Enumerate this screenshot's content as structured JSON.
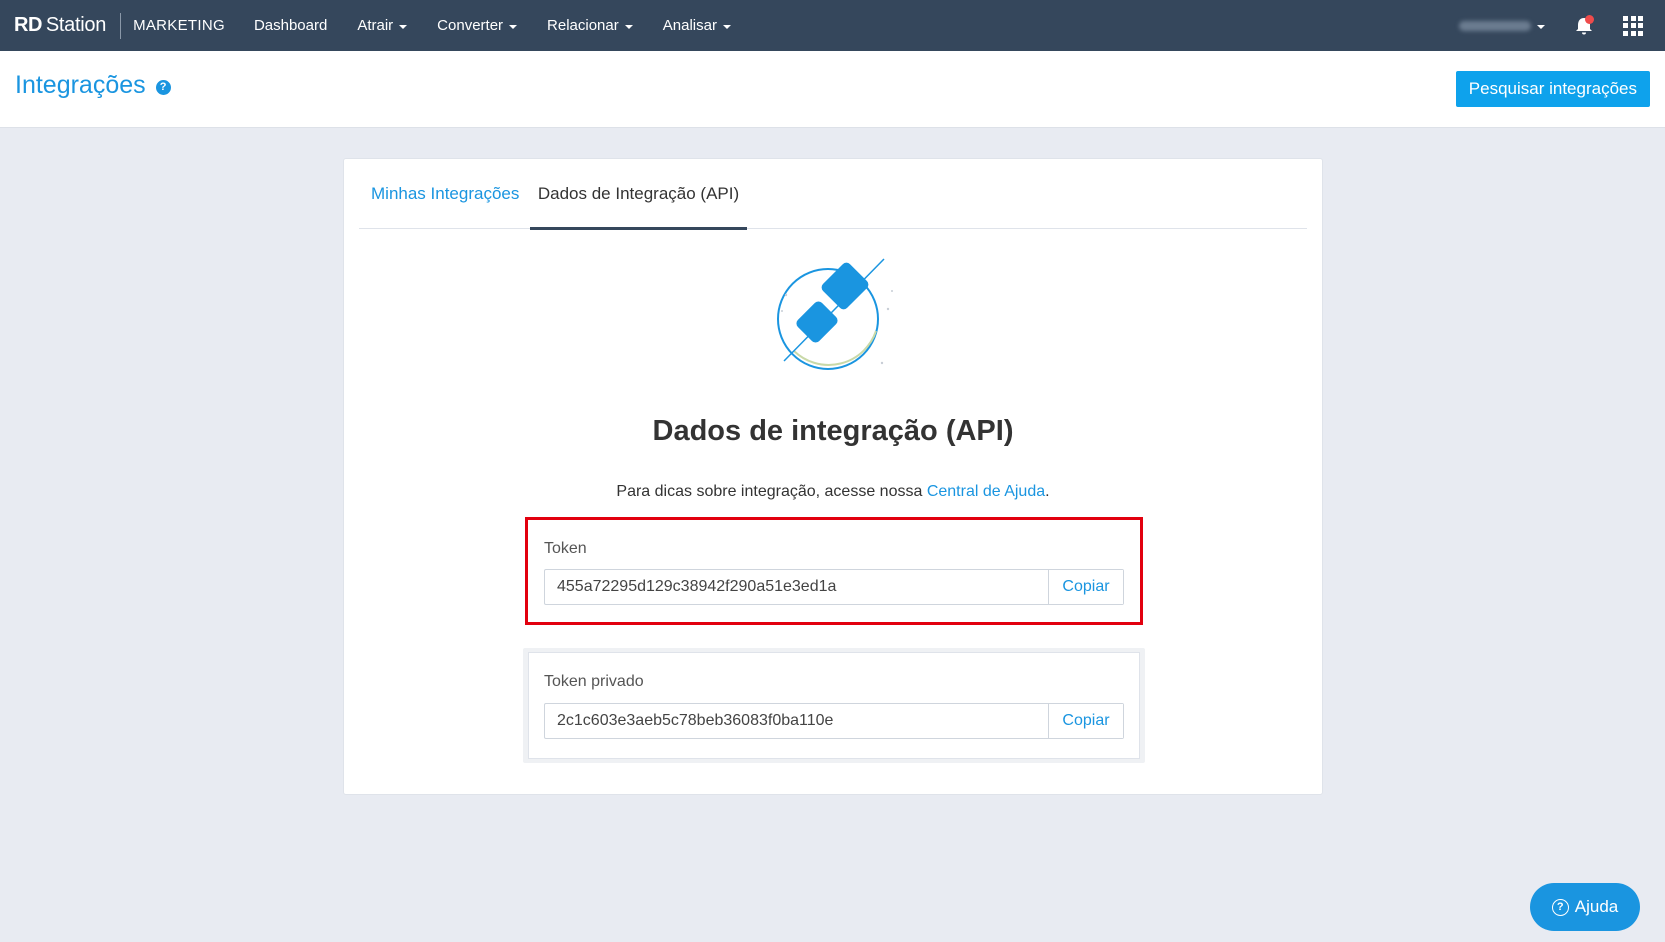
{
  "topnav": {
    "logo_rd": "RD",
    "logo_station": "Station",
    "logo_product": "MARKETING",
    "items": [
      {
        "label": "Dashboard"
      },
      {
        "label": "Atrair"
      },
      {
        "label": "Converter"
      },
      {
        "label": "Relacionar"
      },
      {
        "label": "Analisar"
      }
    ]
  },
  "header": {
    "title": "Integrações",
    "help_icon": "?",
    "search_button": "Pesquisar integrações"
  },
  "tabs": [
    {
      "label": "Minhas Integrações"
    },
    {
      "label": "Dados de Integração (API)"
    }
  ],
  "content": {
    "title": "Dados de integração (API)",
    "desc_prefix": "Para dicas sobre integração, acesse nossa ",
    "desc_link": "Central de Ajuda",
    "desc_suffix": "."
  },
  "token": {
    "label": "Token",
    "value": "455a72295d129c38942f290a51e3ed1a",
    "copy_label": "Copiar"
  },
  "private_token": {
    "label": "Token privado",
    "value": "2c1c603e3aeb5c78beb36083f0ba110e",
    "copy_label": "Copiar"
  },
  "help_button": {
    "icon": "?",
    "label": "Ajuda"
  },
  "colors": {
    "nav_bg": "#35475c",
    "accent": "#1a95e0",
    "highlight": "#e2000f"
  }
}
